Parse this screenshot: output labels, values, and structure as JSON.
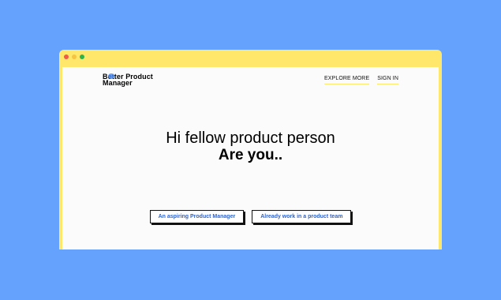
{
  "window": {
    "dots": [
      {
        "name": "close",
        "color": "#ef5a4a"
      },
      {
        "name": "minimize",
        "color": "#f6c343"
      },
      {
        "name": "zoom",
        "color": "#2fb34a"
      }
    ]
  },
  "header": {
    "logo_line1": "Better Product",
    "logo_line2": "Manager",
    "nav": {
      "explore": "EXPLORE MORE",
      "signin": "SIGN IN"
    }
  },
  "hero": {
    "line1": "Hi fellow product person",
    "line2": "Are you.."
  },
  "cta": {
    "aspiring": "An aspiring Product Manager",
    "team": "Already work in a product team"
  },
  "colors": {
    "background": "#64a2fe",
    "window_frame": "#fee76a",
    "content_bg": "#fbfbfb",
    "button_text": "#2f62c8"
  }
}
